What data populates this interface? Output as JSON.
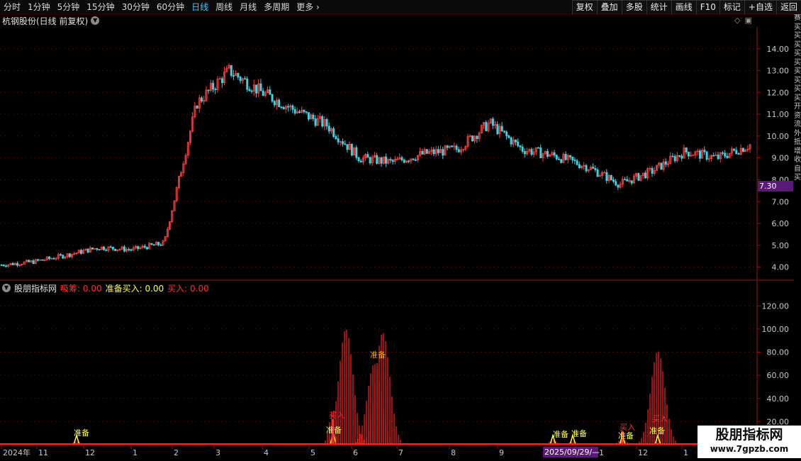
{
  "toolbar": {
    "periods": [
      "分时",
      "1分钟",
      "5分钟",
      "15分钟",
      "30分钟",
      "60分钟",
      "日线",
      "周线",
      "月线",
      "多周期",
      "更多"
    ],
    "active_period": "日线",
    "right_buttons": [
      "复权",
      "叠加",
      "多股",
      "统计",
      "画线",
      "F10",
      "标记",
      "+自选",
      "返回"
    ]
  },
  "main": {
    "title": "杭钢股份(日线 前复权)",
    "price_axis": [
      "14.00",
      "13.00",
      "12.00",
      "11.00",
      "10.00",
      "9.00",
      "8.00",
      "7.00",
      "6.00",
      "5.00",
      "4.00"
    ],
    "current_price": "7.30"
  },
  "indicator": {
    "name": "股朋指标网",
    "values": [
      {
        "label": "吸筹: 0.00",
        "color": "#ff3030"
      },
      {
        "label": "准备买入: 0.00",
        "color": "#ffff40"
      },
      {
        "label": "买入: 0.00",
        "color": "#ff3030"
      }
    ],
    "axis": [
      "120.00",
      "100.00",
      "80.00",
      "60.00",
      "40.00",
      "20.00"
    ],
    "annotations": [
      {
        "text": "准备",
        "color": "#ffff40"
      },
      {
        "text": "买入",
        "color": "#ff3030"
      },
      {
        "text": "准备",
        "color": "#ffff40"
      },
      {
        "text": "准备",
        "color": "#ffaa00"
      },
      {
        "text": "准备",
        "color": "#ffff40"
      },
      {
        "text": "准备",
        "color": "#ffff40"
      },
      {
        "text": "买入",
        "color": "#ff3030"
      },
      {
        "text": "准备",
        "color": "#ffff40"
      },
      {
        "text": "准备",
        "color": "#ffff40"
      },
      {
        "text": "买入",
        "color": "#ff3030"
      }
    ]
  },
  "time_axis": [
    "2024年",
    "11",
    "12",
    "1",
    "2",
    "3",
    "4",
    "5",
    "6",
    "7",
    "8",
    "9",
    "10",
    "11",
    "12",
    "1"
  ],
  "crosshair_date": "2025/09/29/—",
  "right_strip": [
    "赛",
    "买",
    "买",
    "买",
    "买",
    "买",
    "买",
    "买",
    "买",
    "买",
    "开",
    "资",
    "流",
    "外",
    "抵",
    "增",
    "收",
    "自",
    "买"
  ],
  "watermark": {
    "title": "股朋指标网",
    "url": "www.7gpzb.com"
  },
  "chart_data": {
    "type": "candlestick",
    "title": "杭钢股份(日线 前复权)",
    "xlabel": "",
    "ylabel": "",
    "ylim": [
      3.5,
      15.0
    ],
    "x": [
      "2024-10",
      "2024-11",
      "2024-12",
      "2025-01",
      "2025-02",
      "2025-03",
      "2025-04",
      "2025-05",
      "2025-06",
      "2025-07",
      "2025-08",
      "2025-09",
      "2025-10",
      "2025-11",
      "2025-12",
      "2026-01"
    ],
    "series": [
      {
        "values": [
          4.1,
          4.25,
          4.55,
          4.9,
          4.8,
          5.1,
          11.5,
          13.0,
          12.0,
          11.2,
          10.5,
          9.0,
          8.8,
          9.2,
          9.4,
          10.6,
          9.4,
          9.1,
          8.6,
          7.8,
          8.4,
          9.3,
          9.0,
          9.6
        ]
      }
    ],
    "indicator": {
      "name": "股朋指标网",
      "ylim": [
        0,
        130
      ],
      "categories": [
        "2024-11",
        "2025-04 late",
        "2025-05",
        "2025-06",
        "2025-06 late",
        "2025-09",
        "2025-10",
        "2025-11",
        "2025-12"
      ],
      "series": [
        {
          "name": "吸筹",
          "values": [
            3,
            30,
            100,
            70,
            97,
            4,
            3,
            5,
            81
          ]
        },
        {
          "name": "准备买入",
          "values": [
            8,
            12,
            0,
            0,
            0,
            8,
            8,
            8,
            8
          ]
        },
        {
          "name": "买入",
          "values": [
            0,
            22,
            0,
            0,
            0,
            0,
            0,
            12,
            0
          ]
        }
      ]
    }
  }
}
